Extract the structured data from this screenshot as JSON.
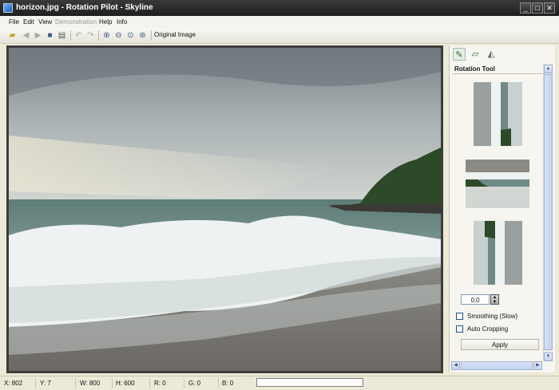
{
  "window": {
    "title": "horizon.jpg - Rotation Pilot - Skyline"
  },
  "menu": {
    "items": [
      "File",
      "Edit",
      "View",
      "Demonstration",
      "Help",
      "Info"
    ],
    "disabled": [
      "Demonstration"
    ]
  },
  "toolbar": {
    "original_image_label": "Original Image"
  },
  "panel": {
    "title": "Rotation Tool",
    "angle_value": "0,0",
    "smoothing_label": "Smoothing (Slow)",
    "autocrop_label": "Auto Cropping",
    "apply_label": "Apply",
    "smoothing_checked": false,
    "autocrop_checked": false
  },
  "status": {
    "x": "X: 802",
    "y": "Y: 7",
    "w": "W: 800",
    "h": "H: 600",
    "r": "R: 0",
    "g": "G: 0",
    "b": "B: 0"
  },
  "colors": {
    "titlebar": "#2b2b2b",
    "panel_bg": "#f6f5f0",
    "accent": "#1c5180"
  }
}
